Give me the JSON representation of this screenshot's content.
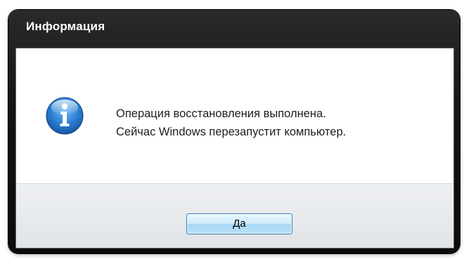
{
  "dialog": {
    "title": "Информация",
    "icon": "info-icon",
    "message_lines": [
      "Операция восстановления выполнена.",
      "Сейчас Windows перезапустит компьютер."
    ],
    "ok_label": "Да"
  },
  "colors": {
    "titlebar": "#141414",
    "title_text": "#ffffff",
    "body_bg": "#ffffff",
    "footer_bg": "#e6e8eb",
    "button_border": "#3c7fb1",
    "icon_blue": "#1f6fc4"
  }
}
